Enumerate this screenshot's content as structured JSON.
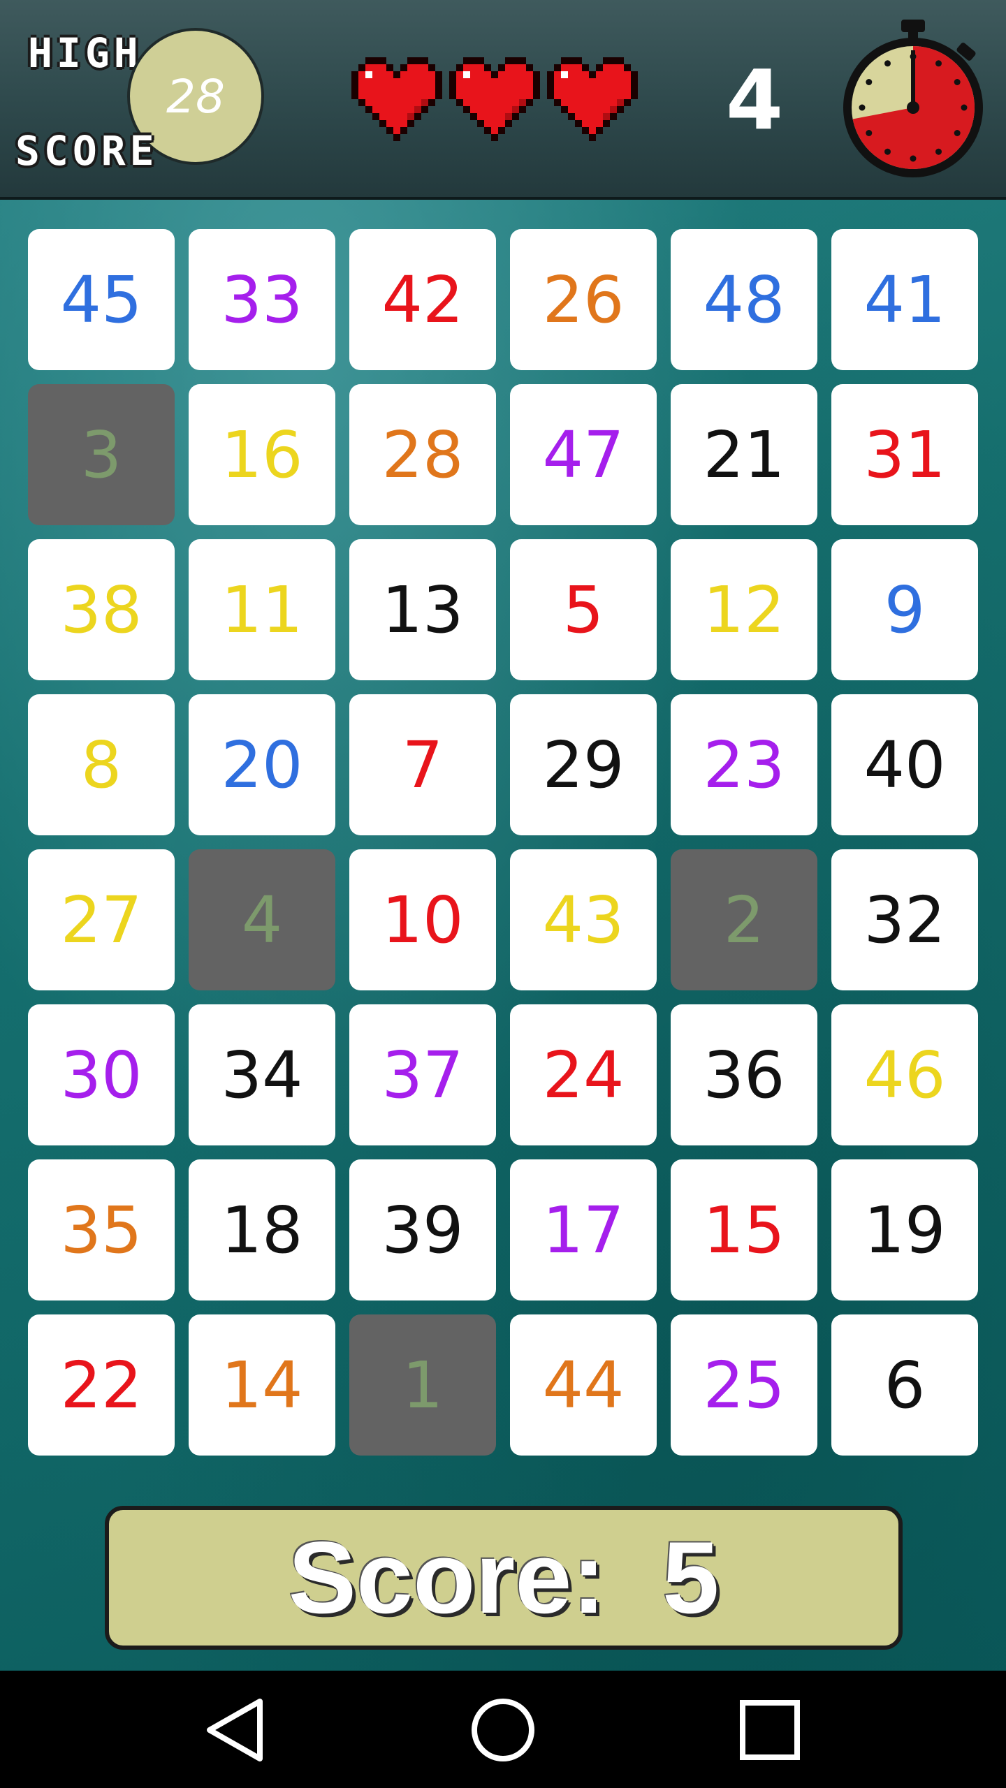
{
  "header": {
    "high_label": "HIGH",
    "score_label": "SCORE",
    "high_score": "28",
    "hearts": [
      "heart",
      "heart",
      "heart"
    ],
    "counter": "4",
    "timer_icon": "stopwatch-icon",
    "timer_remaining_fraction": 0.28
  },
  "colors": {
    "blue": "#2f6fdf",
    "purple": "#a51fec",
    "red": "#e8141b",
    "orange": "#e0761b",
    "yellow": "#ecd51e",
    "black": "#111111",
    "used_text": "#7d9a6c",
    "used_tile": "#636363"
  },
  "board": {
    "rows": [
      [
        {
          "n": "45",
          "c": "blue"
        },
        {
          "n": "33",
          "c": "purple"
        },
        {
          "n": "42",
          "c": "red"
        },
        {
          "n": "26",
          "c": "orange"
        },
        {
          "n": "48",
          "c": "blue"
        },
        {
          "n": "41",
          "c": "blue"
        }
      ],
      [
        {
          "n": "3",
          "c": "used_text",
          "used": true
        },
        {
          "n": "16",
          "c": "yellow"
        },
        {
          "n": "28",
          "c": "orange"
        },
        {
          "n": "47",
          "c": "purple"
        },
        {
          "n": "21",
          "c": "black"
        },
        {
          "n": "31",
          "c": "red"
        }
      ],
      [
        {
          "n": "38",
          "c": "yellow"
        },
        {
          "n": "11",
          "c": "yellow"
        },
        {
          "n": "13",
          "c": "black"
        },
        {
          "n": "5",
          "c": "red"
        },
        {
          "n": "12",
          "c": "yellow"
        },
        {
          "n": "9",
          "c": "blue"
        }
      ],
      [
        {
          "n": "8",
          "c": "yellow"
        },
        {
          "n": "20",
          "c": "blue"
        },
        {
          "n": "7",
          "c": "red"
        },
        {
          "n": "29",
          "c": "black"
        },
        {
          "n": "23",
          "c": "purple"
        },
        {
          "n": "40",
          "c": "black"
        }
      ],
      [
        {
          "n": "27",
          "c": "yellow"
        },
        {
          "n": "4",
          "c": "used_text",
          "used": true
        },
        {
          "n": "10",
          "c": "red"
        },
        {
          "n": "43",
          "c": "yellow"
        },
        {
          "n": "2",
          "c": "used_text",
          "used": true
        },
        {
          "n": "32",
          "c": "black"
        }
      ],
      [
        {
          "n": "30",
          "c": "purple"
        },
        {
          "n": "34",
          "c": "black"
        },
        {
          "n": "37",
          "c": "purple"
        },
        {
          "n": "24",
          "c": "red"
        },
        {
          "n": "36",
          "c": "black"
        },
        {
          "n": "46",
          "c": "yellow"
        }
      ],
      [
        {
          "n": "35",
          "c": "orange"
        },
        {
          "n": "18",
          "c": "black"
        },
        {
          "n": "39",
          "c": "black"
        },
        {
          "n": "17",
          "c": "purple"
        },
        {
          "n": "15",
          "c": "red"
        },
        {
          "n": "19",
          "c": "black"
        }
      ],
      [
        {
          "n": "22",
          "c": "red"
        },
        {
          "n": "14",
          "c": "orange"
        },
        {
          "n": "1",
          "c": "used_text",
          "used": true
        },
        {
          "n": "44",
          "c": "orange"
        },
        {
          "n": "25",
          "c": "purple"
        },
        {
          "n": "6",
          "c": "black"
        }
      ]
    ]
  },
  "score_bar": {
    "text": "Score:  5"
  },
  "nav": {
    "back_icon": "back-triangle-icon",
    "home_icon": "home-circle-icon",
    "recents_icon": "recents-square-icon"
  }
}
